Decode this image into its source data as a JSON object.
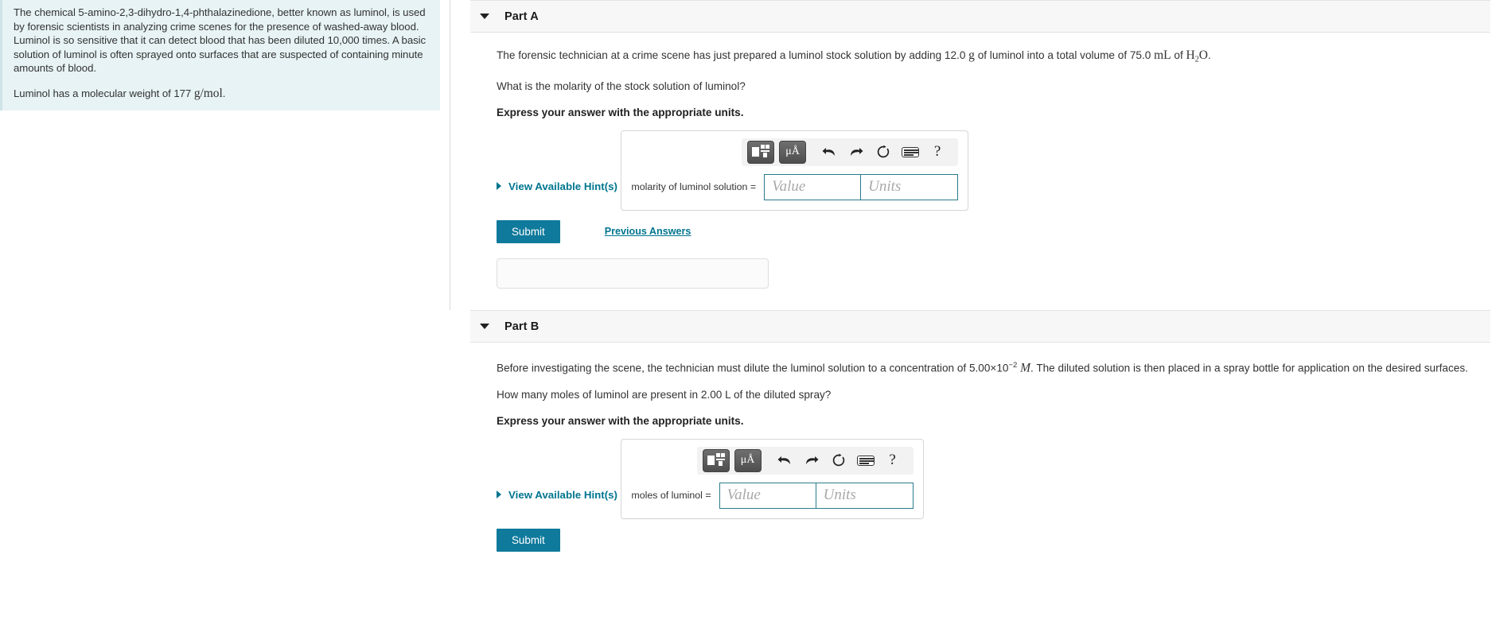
{
  "sidebar": {
    "intro_paragraph": "The chemical 5-amino-2,3-dihydro-1,4-phthalazinedione, better known as luminol, is used by forensic scientists in analyzing crime scenes for the presence of washed-away blood. Luminol is so sensitive that it can detect blood that has been diluted 10,000 times. A basic solution of luminol is often sprayed onto surfaces that are suspected of containing minute amounts of blood.",
    "mw_prefix": "Luminol has a molecular weight of 177 ",
    "mw_units": "g/mol",
    "mw_suffix": "."
  },
  "math_toolbar": {
    "template_button": "template-button",
    "units_button": "μÅ",
    "undo": "undo-arrow",
    "redo": "redo-arrow",
    "reset": "reset-circle",
    "keyboard": "keyboard",
    "help": "?"
  },
  "parts": {
    "a": {
      "title": "Part A",
      "question_1_pre": "The forensic technician at a crime scene has just prepared a luminol stock solution by adding  12.0 ",
      "question_1_g": "g",
      "question_1_mid": " of luminol into a total volume of 75.0 ",
      "question_1_ml": "mL",
      "question_1_of": " of ",
      "question_1_h": "H",
      "question_1_h_sub": "2",
      "question_1_o": "O",
      "question_1_end": ".",
      "question_2": "What is the molarity of the stock solution of luminol?",
      "instruction": "Express your answer with the appropriate units.",
      "hints_label": "View Available Hint(s)",
      "field_label": "molarity of luminol solution =",
      "value_placeholder": "Value",
      "units_placeholder": "Units",
      "submit_label": "Submit",
      "previous_answers_label": "Previous Answers"
    },
    "b": {
      "title": "Part B",
      "question_1_pre": "Before investigating the scene, the technician must dilute the luminol solution to a concentration of 5.00×10",
      "question_1_exp": "−2",
      "question_1_m": "M",
      "question_1_post": ". The diluted solution is then placed in a spray bottle for application on the desired surfaces.",
      "question_2": "How many moles of luminol are present in 2.00 L of the diluted spray?",
      "instruction": "Express your answer with the appropriate units.",
      "hints_label": "View Available Hint(s)",
      "field_label": "moles of luminol =",
      "value_placeholder": "Value",
      "units_placeholder": "Units",
      "submit_label": "Submit"
    }
  },
  "colors": {
    "accent": "#0f7a9c",
    "link": "#00758f",
    "sidebar_bg": "#e7f3f5",
    "field_border": "#2a7b8c"
  }
}
